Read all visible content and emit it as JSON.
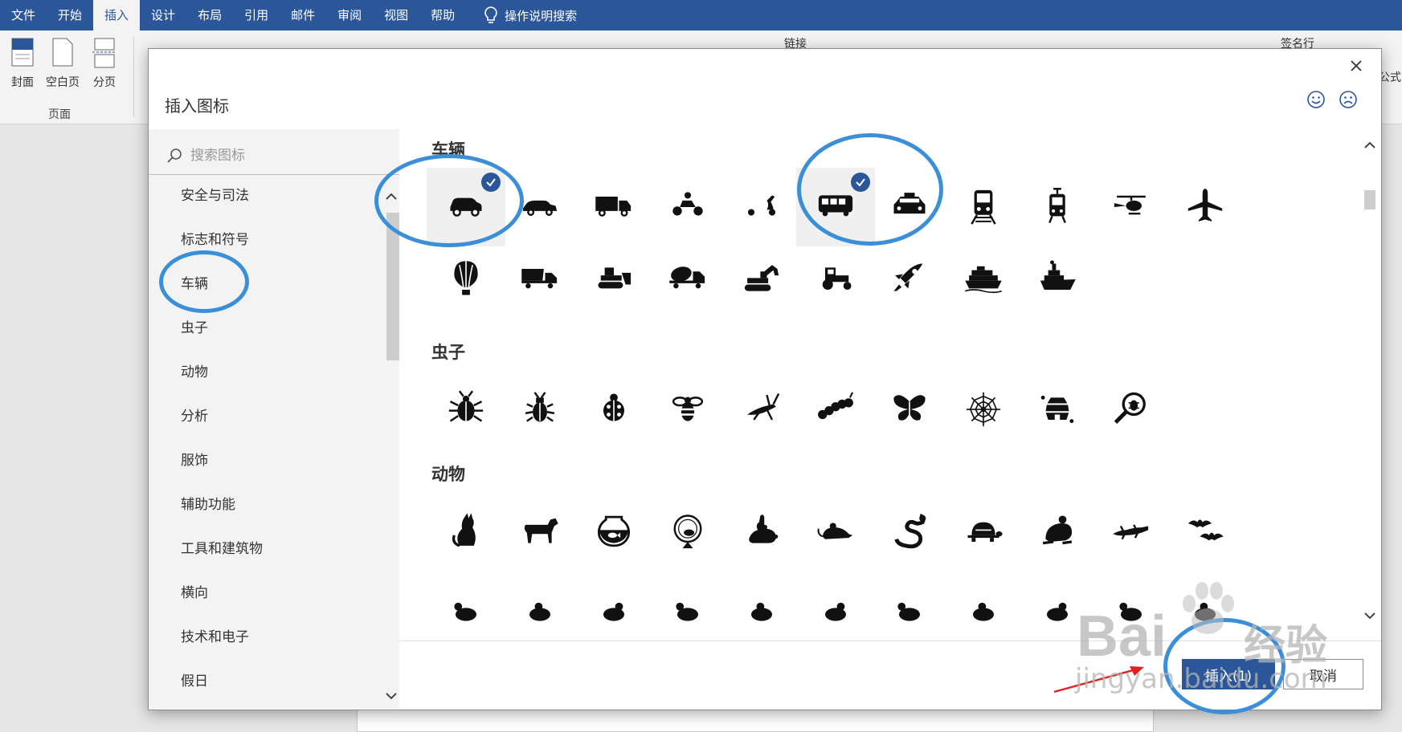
{
  "ribbon": {
    "tabs": [
      "文件",
      "开始",
      "插入",
      "设计",
      "布局",
      "引用",
      "邮件",
      "审阅",
      "视图",
      "帮助"
    ],
    "active_tab": "插入",
    "tell_me": "操作说明搜索",
    "page_group": {
      "cover": "封面",
      "blank": "空白页",
      "break": "分页",
      "label": "页面"
    },
    "link_label": "链接",
    "signature_label": "签名行",
    "equation_label": "公式"
  },
  "dialog": {
    "title": "插入图标",
    "search_placeholder": "搜索图标",
    "categories": [
      "安全与司法",
      "标志和符号",
      "车辆",
      "虫子",
      "动物",
      "分析",
      "服饰",
      "辅助功能",
      "工具和建筑物",
      "横向",
      "技术和电子",
      "假日"
    ],
    "sections": {
      "vehicles": "车辆",
      "bugs": "虫子",
      "animals": "动物"
    },
    "vehicle_icons": [
      "suv-icon",
      "car-icon",
      "truck-icon",
      "motorcycle-icon",
      "scooter-icon",
      "bus-icon",
      "taxi-icon",
      "train-icon",
      "tram-icon",
      "helicopter-icon",
      "airplane-icon",
      "hot-air-balloon-icon",
      "dump-truck-icon",
      "bulldozer-icon",
      "cement-mixer-icon",
      "excavator-icon",
      "tractor-icon",
      "rocket-icon",
      "cruise-ship-icon",
      "steamship-icon"
    ],
    "selected_icons": [
      "suv-icon",
      "bus-icon"
    ],
    "bug_icons": [
      "beetle-icon",
      "stag-beetle-icon",
      "ladybug-icon",
      "bee-icon",
      "grasshopper-icon",
      "caterpillar-icon",
      "butterfly-icon",
      "spider-web-icon",
      "beehive-icon",
      "bug-search-icon"
    ],
    "animal_icons": [
      "cat-icon",
      "dog-icon",
      "fishbowl-icon",
      "hamster-wheel-icon",
      "rabbit-icon",
      "mouse-icon",
      "snake-icon",
      "turtle-icon",
      "frog-icon",
      "lizard-icon",
      "bats-icon"
    ],
    "insert_button": "插入(1)",
    "cancel_button": "取消"
  },
  "colors": {
    "ribbon": "#2b579a",
    "selection_check": "#2b579a",
    "annotation": "#3b8fd9",
    "arrow": "#e02020"
  },
  "watermark": {
    "brand": "Bai",
    "brand_cn": "经验",
    "url": "jingyan.baidu.com"
  }
}
